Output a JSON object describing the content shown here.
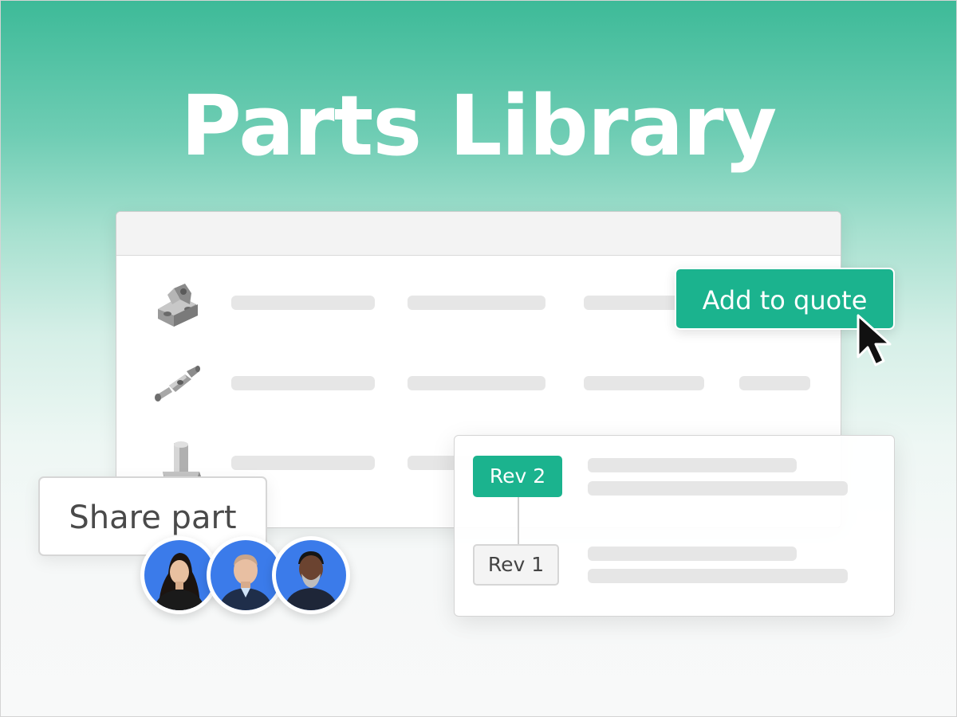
{
  "title": "Parts Library",
  "actions": {
    "add_to_quote": "Add to quote",
    "share_part": "Share part"
  },
  "revisions": [
    {
      "label": "Rev 2"
    },
    {
      "label": "Rev 1"
    }
  ],
  "parts": [
    {
      "icon": "bracket-part-icon"
    },
    {
      "icon": "shaft-part-icon"
    },
    {
      "icon": "post-part-icon"
    }
  ],
  "colors": {
    "accent": "#1bb38e",
    "header_gradient_top": "#3dba98",
    "avatar_background": "#3b7bea",
    "placeholder_bar": "#e6e6e6"
  },
  "avatars": [
    {
      "icon": "avatar-woman-icon"
    },
    {
      "icon": "avatar-man-icon"
    },
    {
      "icon": "avatar-man-beard-icon"
    }
  ]
}
